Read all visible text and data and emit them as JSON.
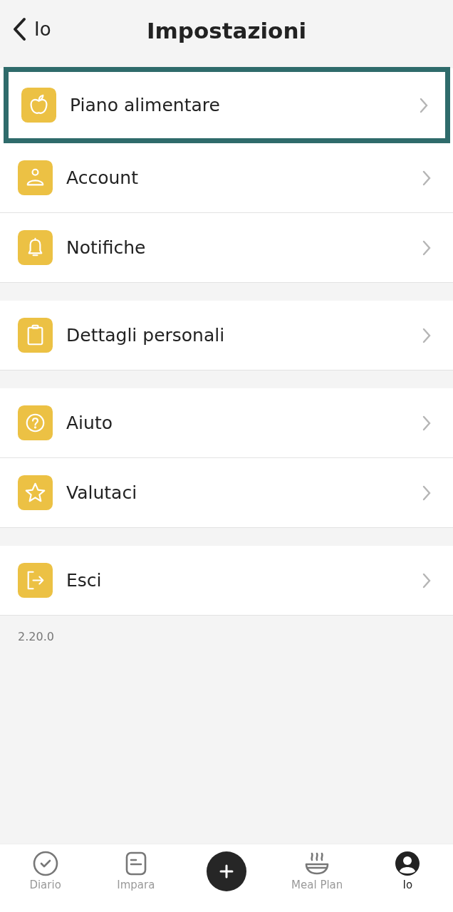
{
  "header": {
    "back_label": "Io",
    "title": "Impostazioni"
  },
  "groups": [
    {
      "items": [
        {
          "kind": "apple",
          "label": "Piano alimentare",
          "highlighted": true
        },
        {
          "kind": "person",
          "label": "Account",
          "highlighted": false
        },
        {
          "kind": "bell",
          "label": "Notifiche",
          "highlighted": false
        }
      ]
    },
    {
      "items": [
        {
          "kind": "clipboard",
          "label": "Dettagli personali",
          "highlighted": false
        }
      ]
    },
    {
      "items": [
        {
          "kind": "help",
          "label": "Aiuto",
          "highlighted": false
        },
        {
          "kind": "star",
          "label": "Valutaci",
          "highlighted": false
        }
      ]
    },
    {
      "items": [
        {
          "kind": "logout",
          "label": "Esci",
          "highlighted": false
        }
      ]
    }
  ],
  "version": "2.20.0",
  "tabs": [
    {
      "kind": "check",
      "label": "Diario",
      "selected": false
    },
    {
      "kind": "doc",
      "label": "Impara",
      "selected": false
    },
    {
      "kind": "add"
    },
    {
      "kind": "bowl",
      "label": "Meal Plan",
      "selected": false
    },
    {
      "kind": "user",
      "label": "Io",
      "selected": true
    }
  ]
}
